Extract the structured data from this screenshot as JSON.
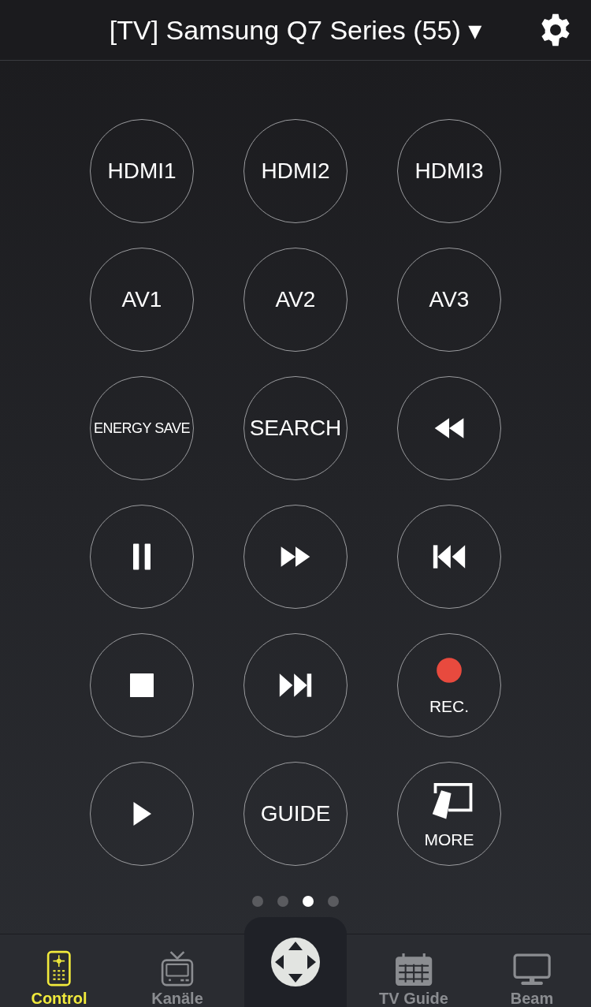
{
  "header": {
    "title": "[TV] Samsung Q7 Series (55) ▾"
  },
  "buttons": [
    {
      "kind": "label",
      "label": "HDMI1"
    },
    {
      "kind": "label",
      "label": "HDMI2"
    },
    {
      "kind": "label",
      "label": "HDMI3"
    },
    {
      "kind": "label",
      "label": "AV1"
    },
    {
      "kind": "label",
      "label": "AV2"
    },
    {
      "kind": "label",
      "label": "AV3"
    },
    {
      "kind": "small-label",
      "label": "ENERGY SAVE"
    },
    {
      "kind": "label",
      "label": "SEARCH"
    },
    {
      "kind": "rewind"
    },
    {
      "kind": "pause"
    },
    {
      "kind": "fast-forward"
    },
    {
      "kind": "skip-back"
    },
    {
      "kind": "stop"
    },
    {
      "kind": "skip-forward"
    },
    {
      "kind": "record",
      "label": "REC."
    },
    {
      "kind": "play"
    },
    {
      "kind": "label",
      "label": "GUIDE"
    },
    {
      "kind": "more",
      "label": "MORE"
    }
  ],
  "pages": [
    {
      "selected": false
    },
    {
      "selected": false
    },
    {
      "selected": true
    },
    {
      "selected": false
    }
  ],
  "tabs": [
    {
      "kind": "remote",
      "label": "Control",
      "selected": true
    },
    {
      "kind": "tv",
      "label": "Kanäle",
      "selected": false
    },
    {
      "kind": "dpad"
    },
    {
      "kind": "calendar",
      "label": "TV Guide",
      "selected": false
    },
    {
      "kind": "monitor",
      "label": "Beam",
      "selected": false
    }
  ]
}
